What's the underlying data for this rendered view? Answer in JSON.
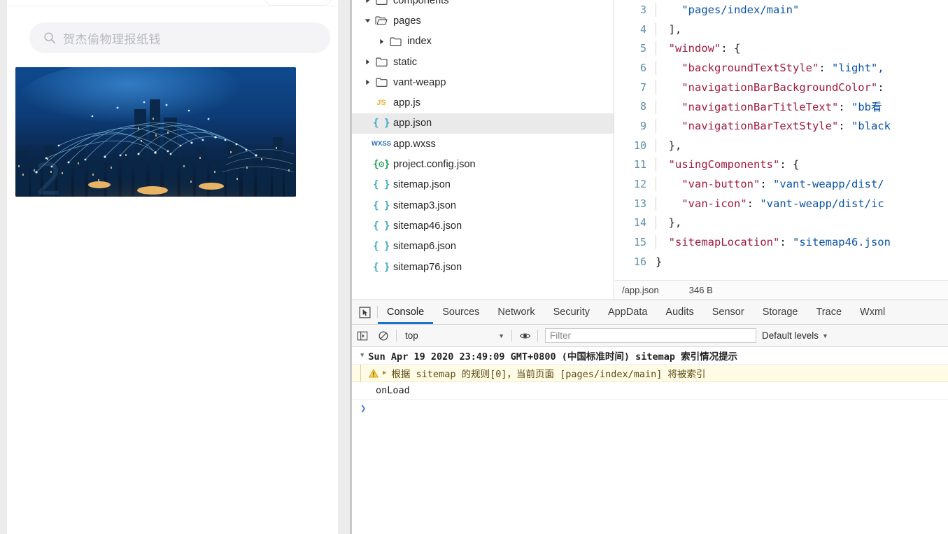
{
  "simulator": {
    "search": {
      "icon": "search-icon",
      "placeholder": "贺杰偷物理报纸钱",
      "value": ""
    },
    "banner_alt": "city-network-banner"
  },
  "filetree": {
    "items": [
      {
        "label": "components",
        "depth": 0,
        "caret": "right",
        "icon": "folder-closed",
        "selected": false,
        "partial": true
      },
      {
        "label": "pages",
        "depth": 0,
        "caret": "down",
        "icon": "folder-open",
        "selected": false
      },
      {
        "label": "index",
        "depth": 1,
        "caret": "right",
        "icon": "folder-closed",
        "selected": false
      },
      {
        "label": "static",
        "depth": 0,
        "caret": "right",
        "icon": "folder-closed",
        "selected": false
      },
      {
        "label": "vant-weapp",
        "depth": 0,
        "caret": "right",
        "icon": "folder-closed",
        "selected": false
      },
      {
        "label": "app.js",
        "depth": 0,
        "caret": "none",
        "icon": "js-icon",
        "selected": false
      },
      {
        "label": "app.json",
        "depth": 0,
        "caret": "none",
        "icon": "json-icon",
        "selected": true
      },
      {
        "label": "app.wxss",
        "depth": 0,
        "caret": "none",
        "icon": "wxss-icon",
        "selected": false
      },
      {
        "label": "project.config.json",
        "depth": 0,
        "caret": "none",
        "icon": "config-icon",
        "selected": false
      },
      {
        "label": "sitemap.json",
        "depth": 0,
        "caret": "none",
        "icon": "json-icon",
        "selected": false
      },
      {
        "label": "sitemap3.json",
        "depth": 0,
        "caret": "none",
        "icon": "json-icon",
        "selected": false
      },
      {
        "label": "sitemap46.json",
        "depth": 0,
        "caret": "none",
        "icon": "json-icon",
        "selected": false
      },
      {
        "label": "sitemap6.json",
        "depth": 0,
        "caret": "none",
        "icon": "json-icon",
        "selected": false
      },
      {
        "label": "sitemap76.json",
        "depth": 0,
        "caret": "none",
        "icon": "json-icon",
        "selected": false
      }
    ]
  },
  "editor": {
    "lines": [
      {
        "no": "3",
        "indent": 2,
        "guides": 1,
        "tokens": [
          {
            "t": "str",
            "v": "\"pages/index/main\""
          }
        ]
      },
      {
        "no": "4",
        "indent": 1,
        "guides": 0,
        "tokens": [
          {
            "t": "pun",
            "v": "],"
          }
        ]
      },
      {
        "no": "5",
        "indent": 1,
        "guides": 0,
        "tokens": [
          {
            "t": "key",
            "v": "\"window\""
          },
          {
            "t": "pun",
            "v": ": {"
          }
        ]
      },
      {
        "no": "6",
        "indent": 2,
        "guides": 1,
        "tokens": [
          {
            "t": "key",
            "v": "\"backgroundTextStyle\""
          },
          {
            "t": "pun",
            "v": ": "
          },
          {
            "t": "str",
            "v": "\"light\","
          }
        ]
      },
      {
        "no": "7",
        "indent": 2,
        "guides": 1,
        "tokens": [
          {
            "t": "key",
            "v": "\"navigationBarBackgroundColor\""
          },
          {
            "t": "pun",
            "v": ":"
          }
        ]
      },
      {
        "no": "8",
        "indent": 2,
        "guides": 1,
        "tokens": [
          {
            "t": "key",
            "v": "\"navigationBarTitleText\""
          },
          {
            "t": "pun",
            "v": ": "
          },
          {
            "t": "str",
            "v": "\"bb看"
          }
        ]
      },
      {
        "no": "9",
        "indent": 2,
        "guides": 1,
        "tokens": [
          {
            "t": "key",
            "v": "\"navigationBarTextStyle\""
          },
          {
            "t": "pun",
            "v": ": "
          },
          {
            "t": "str",
            "v": "\"black"
          }
        ]
      },
      {
        "no": "10",
        "indent": 1,
        "guides": 0,
        "tokens": [
          {
            "t": "pun",
            "v": "},"
          }
        ]
      },
      {
        "no": "11",
        "indent": 1,
        "guides": 0,
        "tokens": [
          {
            "t": "key",
            "v": "\"usingComponents\""
          },
          {
            "t": "pun",
            "v": ": {"
          }
        ]
      },
      {
        "no": "12",
        "indent": 2,
        "guides": 1,
        "tokens": [
          {
            "t": "key",
            "v": "\"van-button\""
          },
          {
            "t": "pun",
            "v": ": "
          },
          {
            "t": "str",
            "v": "\"vant-weapp/dist/"
          }
        ]
      },
      {
        "no": "13",
        "indent": 2,
        "guides": 1,
        "tokens": [
          {
            "t": "key",
            "v": "\"van-icon\""
          },
          {
            "t": "pun",
            "v": ": "
          },
          {
            "t": "str",
            "v": "\"vant-weapp/dist/ic"
          }
        ]
      },
      {
        "no": "14",
        "indent": 1,
        "guides": 0,
        "tokens": [
          {
            "t": "pun",
            "v": "},"
          }
        ]
      },
      {
        "no": "15",
        "indent": 1,
        "guides": 0,
        "tokens": [
          {
            "t": "key",
            "v": "\"sitemapLocation\""
          },
          {
            "t": "pun",
            "v": ": "
          },
          {
            "t": "str",
            "v": "\"sitemap46.json"
          }
        ]
      },
      {
        "no": "16",
        "indent": 0,
        "guides": 0,
        "tokens": [
          {
            "t": "pun",
            "v": "}"
          }
        ]
      }
    ]
  },
  "statusbar": {
    "filepath": "/app.json",
    "filesize": "346 B"
  },
  "devtools_tabs": {
    "inspect_icon": "inspect-cursor-icon",
    "items": [
      {
        "label": "Console",
        "active": true
      },
      {
        "label": "Sources",
        "active": false
      },
      {
        "label": "Network",
        "active": false
      },
      {
        "label": "Security",
        "active": false
      },
      {
        "label": "AppData",
        "active": false
      },
      {
        "label": "Audits",
        "active": false
      },
      {
        "label": "Sensor",
        "active": false
      },
      {
        "label": "Storage",
        "active": false
      },
      {
        "label": "Trace",
        "active": false
      },
      {
        "label": "Wxml",
        "active": false
      }
    ]
  },
  "console_toolbar": {
    "sidebar_icon": "console-sidebar-icon",
    "clear_icon": "clear-console-icon",
    "context_value": "top",
    "context_arrow": "▼",
    "eye_icon": "live-expression-eye-icon",
    "filter_placeholder": "Filter",
    "filter_value": "",
    "levels_label": "Default levels",
    "levels_arrow": "▼"
  },
  "console_body": {
    "rows": [
      {
        "kind": "group",
        "triangle": "▼",
        "text": "Sun Apr 19 2020 23:49:09 GMT+0800 (中国标准时间) sitemap 索引情况提示"
      },
      {
        "kind": "warning",
        "icon": "warning-triangle-icon",
        "triangle": "▶",
        "text": "根据 sitemap 的规则[0]，当前页面 [pages/index/main] 将被索引"
      },
      {
        "kind": "log",
        "text": "onLoad"
      },
      {
        "kind": "prompt",
        "chevron": "❯"
      }
    ]
  },
  "colors": {
    "accent": "#1a73c7",
    "selected_row": "#eaeaea",
    "warning_bg": "#fffbe5",
    "json_key": "#a01b3e",
    "json_string": "#0b54a6",
    "line_number": "#5b8fa8"
  }
}
